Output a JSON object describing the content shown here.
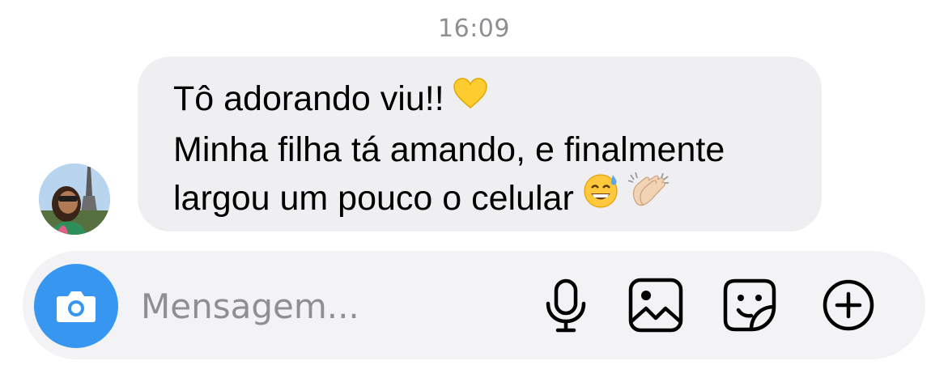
{
  "chat": {
    "timestamp": "16:09",
    "message": {
      "lines": [
        "Tô adorando viu!!",
        "Minha filha tá amando, e finalmente",
        "largou um pouco o celular"
      ],
      "emojis": [
        "yellow-heart",
        "sweat-smile",
        "clapping-hands"
      ]
    },
    "avatar": {
      "icon": "profile-photo-avatar"
    }
  },
  "composer": {
    "placeholder": "Mensagem...",
    "value": "",
    "camera_icon": "camera-icon",
    "actions": [
      "microphone-icon",
      "gallery-icon",
      "sticker-icon",
      "plus-circle-icon"
    ],
    "accent_color": "#3797f0"
  },
  "colors": {
    "bubble_background": "#efeff2",
    "composer_background": "#f3f3f5",
    "timestamp_color": "#8e8e93"
  }
}
